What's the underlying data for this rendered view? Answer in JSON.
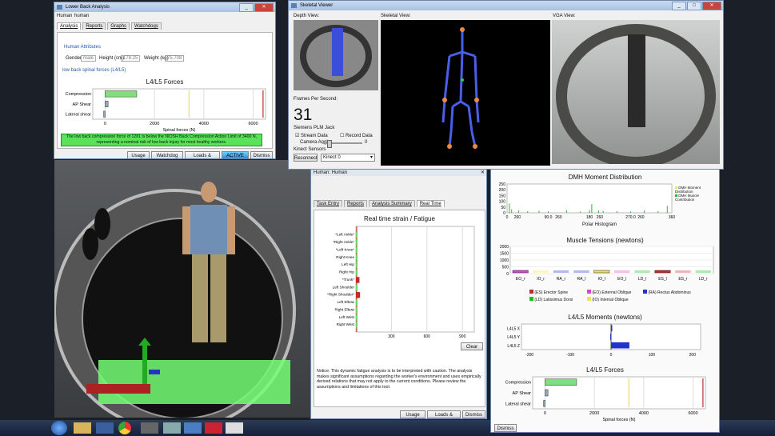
{
  "colors": {
    "compression_bar": "#7fdf7f",
    "safe_green": "#58e358",
    "accent_red": "#c42a2a",
    "blue_bar": "#2233cc",
    "moment_green": "#22bb22",
    "yellow_line": "#f0e060"
  },
  "lower_back_window": {
    "title": "Lower Back Analysis",
    "human_label": "Human",
    "human_value": "human",
    "tabs": [
      "Analysis",
      "Reports",
      "Graphs",
      "Watchdogs"
    ],
    "attributes_title": "Human Attributes",
    "gender_label": "Gender",
    "gender_value": "male",
    "height_label": "Height (cm)",
    "height_value": "178.25",
    "weight_label": "Weight (kg)",
    "weight_value": "75.708",
    "forces_link": "low back spinal forces (L4/L5)",
    "chart_title": "L4/L5 Forces",
    "status_text": "The low back compression force of 1281 is below the NIOSH Back Compression Action Limit of 3400 N, representing a nominal risk of low back injury for most healthy workers.",
    "buttons": [
      "Usage",
      "Watchdog Only",
      "Loads & Weights",
      "ACTIVE",
      "Dismiss"
    ]
  },
  "skeletal_window": {
    "title": "Skeletal Viewer",
    "depth_label": "Depth View:",
    "skeletal_label": "Skeletal View:",
    "vga_label": "VGA View:",
    "fps_label": "Frames Per Second:",
    "fps_value": "31",
    "device_label": "Siemens PLM Jack",
    "stream_label": "Stream Data",
    "record_label": "Record Data",
    "camera_label": "Camera Angle:",
    "camera_value": "0",
    "sensors_label": "Kinect Sensors",
    "reconnect_label": "Reconnect",
    "sensor_select": "Kinect 0"
  },
  "fatigue_window": {
    "title": "Human: Human",
    "tabs": [
      "Task Entry",
      "Reports",
      "Analysis Summary",
      "Real Time"
    ],
    "chart_title": "Real time strain / Fatigue",
    "notice": "Notice: This dynamic fatigue analysis is to be interpreted with caution.  The analysis makes significant assumptions regarding the worker's environment and uses empirically derived relations that may not apply to the current conditions.  Please review the assumptions and limitations of this tool.",
    "clear_label": "Clear",
    "buttons": [
      "Usage",
      "Loads & Weights",
      "Dismiss"
    ]
  },
  "analysis_panel": {
    "dmh_title": "DMH Moment Distribution",
    "dmh_xlabel": "Polar Histogram",
    "dmh_legend": [
      "DMH Moment Distribution",
      "DMH Muscle Contribution"
    ],
    "muscle_title": "Muscle Tensions (newtons)",
    "muscle_legend": [
      "(ES) Erector Spine",
      "(EO) External Oblique",
      "(RA) Rectus Abdominus",
      "(LD) Latissimus Dorsi",
      "(IO) Internal Oblique"
    ],
    "moments_title": "L4/L5 Moments (newtons)",
    "forces_title": "L4/L5 Forces",
    "dismiss_label": "Dismiss"
  },
  "chart_data": [
    {
      "type": "bar",
      "title": "L4/L5 Forces",
      "orientation": "horizontal",
      "categories": [
        "Compression",
        "AP Shear",
        "Lateral shear"
      ],
      "values": [
        1281,
        120,
        -60
      ],
      "xlabel": "Spinal forces (N)",
      "xticks": [
        0,
        2000,
        4000,
        6000
      ],
      "xlim": [
        -500,
        6500
      ],
      "reference_lines": [
        3400,
        6400
      ]
    },
    {
      "type": "bar",
      "title": "Real time strain / Fatigue",
      "orientation": "horizontal",
      "categories": [
        "*Left Ankle*",
        "*Right Ankle*",
        "*Left Knee*",
        "Right Knee",
        "Left Hip",
        "Right Hip",
        "*Trunk*",
        "Left Shoulder",
        "*Right Shoulder*",
        "Left Elbow",
        "Right Elbow",
        "Left Wrist",
        "Right Wrist"
      ],
      "values": [
        2,
        2,
        2,
        2,
        2,
        2,
        30,
        2,
        35,
        2,
        2,
        2,
        2
      ],
      "xticks": [
        300,
        600,
        900
      ],
      "xlim": [
        0,
        1000
      ]
    },
    {
      "type": "bar",
      "title": "DMH Moment Distribution",
      "xlabel": "Polar Histogram",
      "xticks": [
        "0",
        "90.0",
        "180",
        "270.0",
        "360"
      ],
      "xtick_extras": [
        "260",
        "260",
        "260",
        "260"
      ],
      "yticks": [
        0,
        50,
        100,
        150,
        200,
        250
      ],
      "x": [
        5,
        10,
        25,
        45,
        70,
        90,
        130,
        160,
        180,
        185,
        200,
        210,
        240,
        270,
        300,
        330,
        350
      ],
      "values": [
        80,
        30,
        20,
        15,
        18,
        12,
        22,
        10,
        25,
        75,
        20,
        18,
        15,
        12,
        20,
        15,
        60
      ]
    },
    {
      "type": "bar",
      "title": "Muscle Tensions (newtons)",
      "categories": [
        "EO_r",
        "IO_r",
        "RA_r",
        "RA_l",
        "IO_l",
        "EO_l",
        "LD_l",
        "ES_l",
        "ES_r",
        "LD_r"
      ],
      "values": [
        180,
        0,
        0,
        0,
        200,
        0,
        0,
        150,
        0,
        0
      ],
      "yticks": [
        0,
        500,
        1000,
        1500,
        2000
      ]
    },
    {
      "type": "bar",
      "title": "L4/L5 Moments (newtons)",
      "orientation": "horizontal",
      "categories": [
        "L4L5 X",
        "L4L5 Y",
        "L4L5 Z"
      ],
      "values": [
        3,
        -2,
        45
      ],
      "xticks": [
        -200,
        -100,
        0,
        100,
        200
      ],
      "xlim": [
        -220,
        220
      ]
    },
    {
      "type": "bar",
      "title": "L4/L5 Forces",
      "orientation": "horizontal",
      "categories": [
        "Compression",
        "AP Shear",
        "Lateral shear"
      ],
      "values": [
        1281,
        120,
        -60
      ],
      "xlabel": "Spinal forces (N)",
      "xticks": [
        0,
        2000,
        4000,
        6000
      ],
      "xlim": [
        -500,
        6500
      ],
      "reference_lines": [
        3400,
        6400
      ]
    }
  ]
}
